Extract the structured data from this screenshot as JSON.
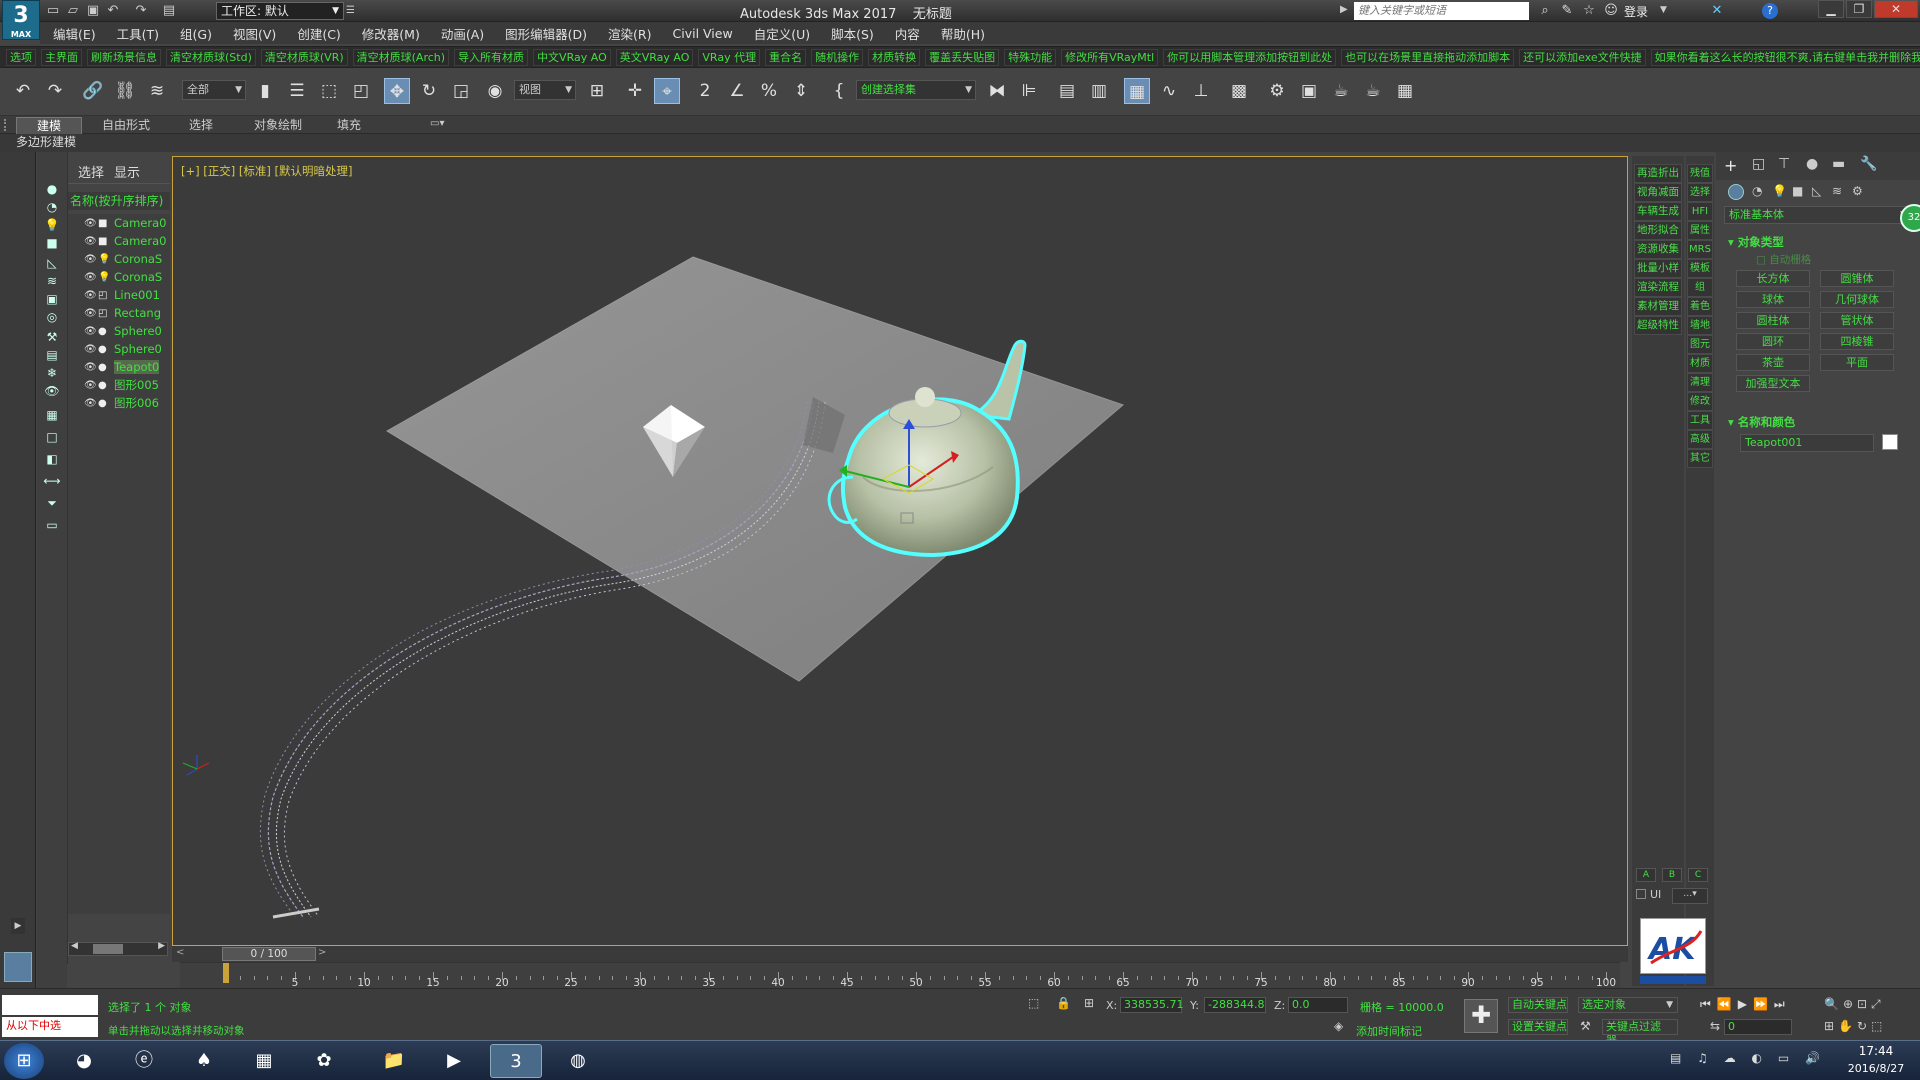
{
  "titlebar": {
    "app_title": "Autodesk 3ds Max 2017",
    "doc_title": "无标题",
    "workspace": "工作区: 默认",
    "search_placeholder": "键入关键字或短语",
    "login": "登录",
    "logo_text": "3",
    "logo_sub": "MAX"
  },
  "menu": [
    "编辑(E)",
    "工具(T)",
    "组(G)",
    "视图(V)",
    "创建(C)",
    "修改器(M)",
    "动画(A)",
    "图形编辑器(D)",
    "渲染(R)",
    "Civil View",
    "自定义(U)",
    "脚本(S)",
    "内容",
    "帮助(H)"
  ],
  "script_buttons": [
    "选项",
    "主界面",
    "刷新场景信息",
    "清空材质球(Std)",
    "清空材质球(VR)",
    "清空材质球(Arch)",
    "导入所有材质",
    "中文VRay AO",
    "英文VRay AO",
    "VRay 代理",
    "重合名",
    "随机操作",
    "材质转换",
    "覆盖丢失贴图",
    "特殊功能",
    "修改所有VRayMtl",
    "你可以用脚本管理添加按钮到此处",
    "也可以在场景里直接拖动添加脚本",
    "还可以添加exe文件快捷",
    "如果你看着这么长的按钮很不爽,请右键单击我并删除我"
  ],
  "toolbar": {
    "filter": "全部",
    "view_dropdown": "视图",
    "selection_set": "创建选择集"
  },
  "ribbon": {
    "tabs": [
      "建模",
      "自由形式",
      "选择",
      "对象绘制",
      "填充"
    ],
    "active": "建模",
    "subpanel": "多边形建模"
  },
  "scene_explorer": {
    "tabs": [
      "选择",
      "显示"
    ],
    "column_header": "名称(按升序排序)",
    "items": [
      {
        "name": "Camera0",
        "icon": "camera-icon"
      },
      {
        "name": "Camera0",
        "icon": "camera-icon"
      },
      {
        "name": "CoronaS",
        "icon": "light-icon"
      },
      {
        "name": "CoronaS",
        "icon": "light-icon"
      },
      {
        "name": "Line001",
        "icon": "shape-icon"
      },
      {
        "name": "Rectang",
        "icon": "shape-icon"
      },
      {
        "name": "Sphere0",
        "icon": "geometry-icon"
      },
      {
        "name": "Sphere0",
        "icon": "geometry-icon"
      },
      {
        "name": "Teapot0",
        "icon": "geometry-icon",
        "selected": true
      },
      {
        "name": "图形005",
        "icon": "geometry-icon"
      },
      {
        "name": "图形006",
        "icon": "geometry-icon"
      }
    ]
  },
  "viewport": {
    "label": "[+] [正交] [标准] [默认明暗处理]"
  },
  "right_strip": {
    "col1": [
      "再造折出",
      "视角减面",
      "车辆生成",
      "地形拟合",
      "资源收集",
      "批量小样",
      "渲染流程",
      "素材管理",
      "超级特性"
    ],
    "col2": [
      "残值",
      "选择",
      "HFI",
      "属性",
      "MRS",
      "模板",
      "组",
      "着色",
      "墙地",
      "图元",
      "材质",
      "清理",
      "修改",
      "工具",
      "高级",
      "其它"
    ],
    "bottom": [
      "A",
      "B",
      "C"
    ],
    "ui_label": "UI"
  },
  "command_panel": {
    "dropdown": "标准基本体",
    "object_type_title": "对象类型",
    "autogrid": "自动栅格",
    "buttons": [
      "长方体",
      "圆锥体",
      "球体",
      "几何球体",
      "圆柱体",
      "管状体",
      "圆环",
      "四棱锥",
      "茶壶",
      "平面",
      "加强型文本"
    ],
    "name_color_title": "名称和颜色",
    "object_name": "Teapot001",
    "badge": "32"
  },
  "timeline": {
    "frame": "0 / 100",
    "ticks": [
      0,
      5,
      10,
      15,
      20,
      25,
      30,
      35,
      40,
      45,
      50,
      55,
      60,
      65,
      70,
      75,
      80,
      85,
      90,
      95,
      100
    ],
    "labels": [
      "5",
      "10",
      "15",
      "20",
      "25",
      "30",
      "35",
      "40",
      "45",
      "50",
      "55",
      "60",
      "65",
      "70",
      "75",
      "80",
      "85",
      "90",
      "95",
      "100"
    ]
  },
  "status": {
    "left_red": "从以下中选",
    "selected": "选择了 1 个 对象",
    "hint": "单击并拖动以选择并移动对象",
    "x_label": "X:",
    "x": "338535.71",
    "y_label": "Y:",
    "y": "-288344.8",
    "z_label": "Z:",
    "z": "0.0",
    "grid": "栅格 = 10000.0",
    "add_time_tag": "添加时间标记",
    "auto_key": "自动关键点",
    "set_key": "设置关键点",
    "selected_obj": "选定对象",
    "key_filter": "关键点过滤器...",
    "frame_num": "0"
  },
  "taskbar": {
    "time": "17:44",
    "date": "2016/8/27"
  }
}
